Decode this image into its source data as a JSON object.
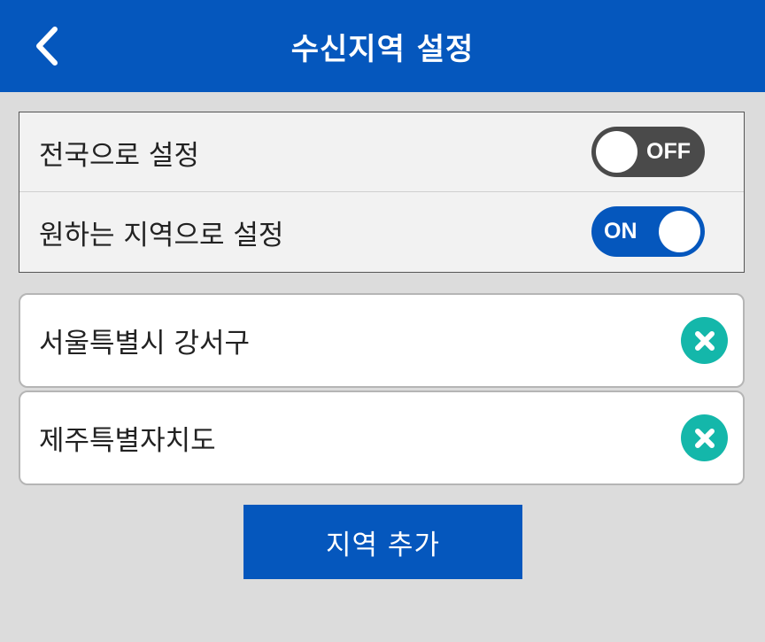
{
  "header": {
    "title": "수신지역 설정",
    "back_icon": "chevron-left-icon"
  },
  "settings": {
    "nationwide": {
      "label": "전국으로 설정",
      "toggle_text": "OFF",
      "state": "off"
    },
    "custom": {
      "label": "원하는 지역으로 설정",
      "toggle_text": "ON",
      "state": "on"
    }
  },
  "regions": [
    {
      "name": "서울특별시 강서구",
      "remove_icon": "close-circle-icon"
    },
    {
      "name": "제주특별자치도",
      "remove_icon": "close-circle-icon"
    }
  ],
  "add_button": {
    "label": "지역 추가"
  },
  "colors": {
    "primary": "#0557bd",
    "toggle_off": "#4a4a4a",
    "remove_accent": "#14b7aa",
    "background": "#dcdcdc"
  }
}
